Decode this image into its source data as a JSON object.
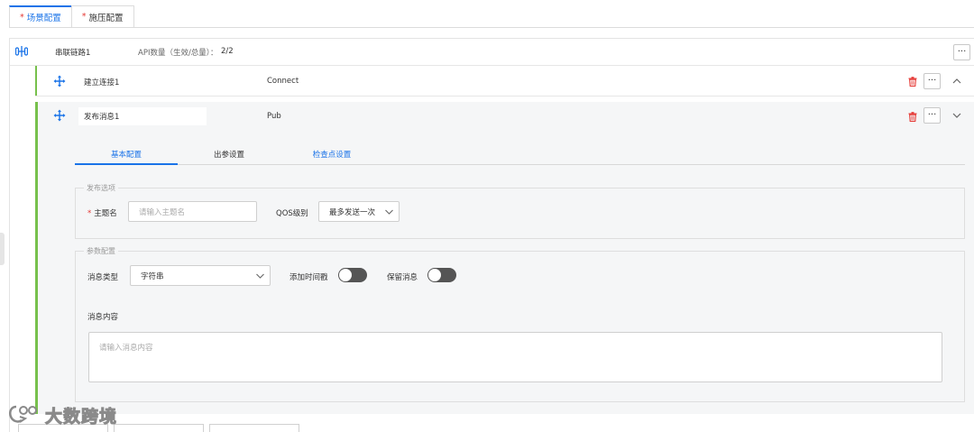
{
  "top_tabs": [
    {
      "label": "场景配置",
      "required_mark": "*"
    },
    {
      "label": "施压配置",
      "required_mark": "*"
    }
  ],
  "chain": {
    "name": "串联链路1",
    "api_count_label": "API数量（生效/总量）：",
    "api_count_value": "2/2",
    "more": "···"
  },
  "apis": [
    {
      "name": "建立连接1",
      "type": "Connect",
      "more": "···",
      "expanded": false
    },
    {
      "name": "发布消息1",
      "type": "Pub",
      "more": "···",
      "expanded": true
    }
  ],
  "sub_tabs": [
    "基本配置",
    "出参设置",
    "检查点设置"
  ],
  "publish_options": {
    "legend": "发布选项",
    "required_mark": "*",
    "topic_label": "主题名",
    "topic_placeholder": "请输入主题名",
    "qos_label": "QOS级别",
    "qos_value": "最多发送一次"
  },
  "param_config": {
    "legend": "参数配置",
    "msg_type_label": "消息类型",
    "msg_type_value": "字符串",
    "add_timestamp_label": "添加时间戳",
    "add_timestamp_on": false,
    "retain_label": "保留消息",
    "retain_on": false,
    "content_label": "消息内容",
    "content_placeholder": "请输入消息内容"
  },
  "watermark": "大数跨境",
  "colors": {
    "accent": "#1a73e8",
    "green_bar": "#77c04c",
    "danger": "#e53935",
    "toggle_off": "#555555"
  },
  "icons": [
    "chain-link-icon",
    "move-icon",
    "trash-icon",
    "chevron-up-icon",
    "chevron-down-icon",
    "more-icon"
  ]
}
